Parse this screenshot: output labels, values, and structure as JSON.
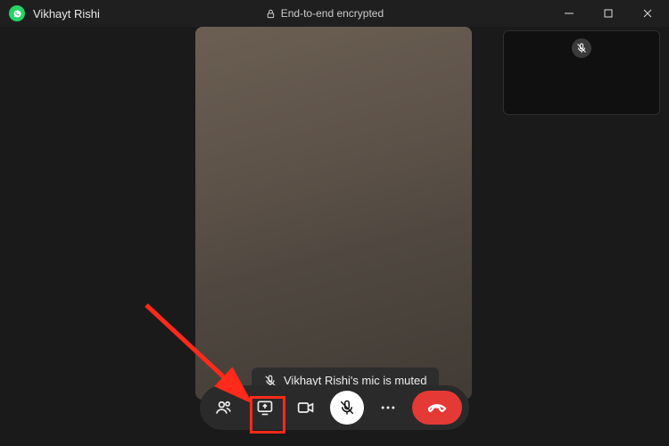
{
  "titlebar": {
    "app_title": "Vikhayt Rishi",
    "encrypted_label": "End-to-end encrypted"
  },
  "toast": {
    "muted_text": "Vikhayt Rishi's mic is muted"
  },
  "icons": {
    "app": "whatsapp-icon",
    "lock": "lock-icon",
    "minimize": "minimize-icon",
    "maximize": "maximize-icon",
    "close": "close-icon",
    "mic_muted": "mic-muted-icon",
    "participants": "participants-icon",
    "share_screen": "share-screen-icon",
    "video": "video-icon",
    "more": "more-icon",
    "end_call": "end-call-icon"
  },
  "colors": {
    "accent_green": "#25D366",
    "end_call_red": "#e53935",
    "highlight_red": "#ff2a1a"
  }
}
